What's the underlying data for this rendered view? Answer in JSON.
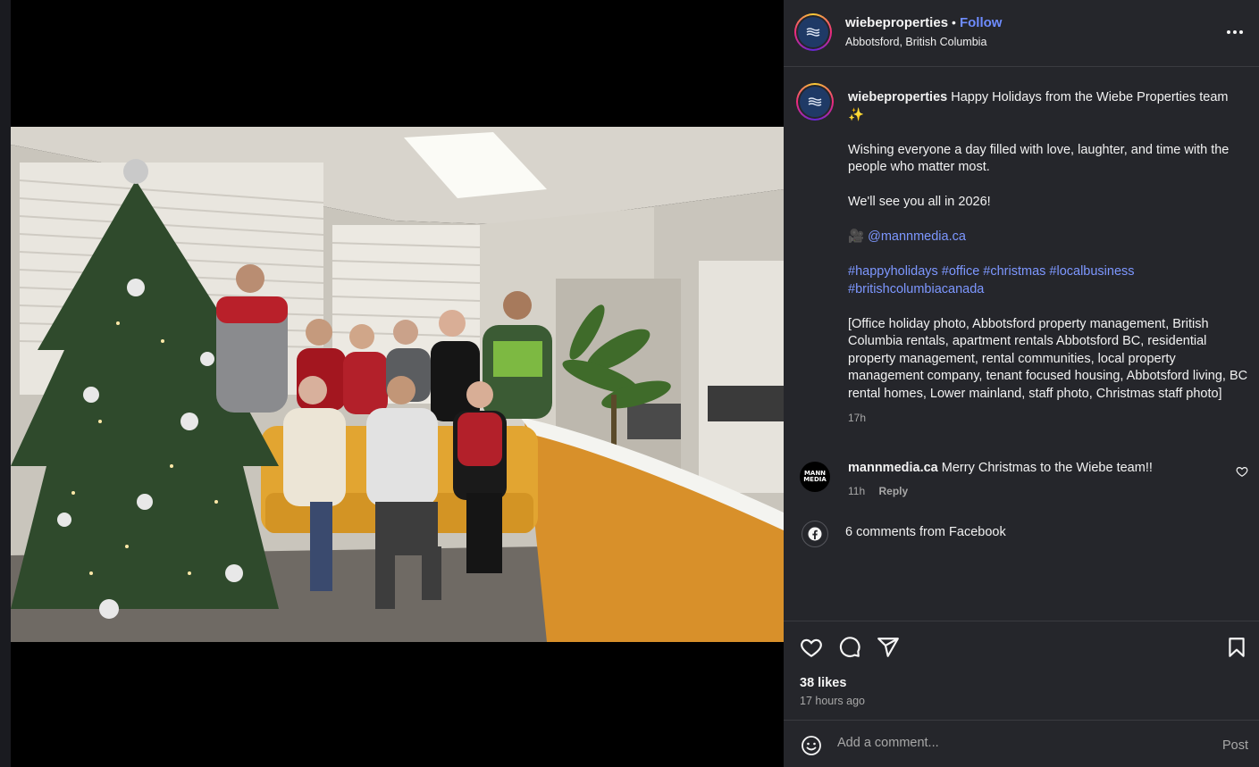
{
  "post": {
    "username": "wiebeproperties",
    "dot": "•",
    "follow_label": "Follow",
    "location": "Abbotsford, British Columbia",
    "more_icon": "more-horizontal-icon"
  },
  "caption": {
    "username": "wiebeproperties",
    "title": "Happy Holidays from the Wiebe Properties team",
    "sparkle": "✨",
    "line1": "Wishing everyone a day filled with love, laughter, and time with the people who matter most.",
    "line2": "We'll see you all in 2026!",
    "camera_emoji": "🎥",
    "mention": "@mannmedia.ca",
    "hashtags_1": "#happyholidays #office #christmas #localbusiness",
    "hashtags_2": "#britishcolumbiacanada",
    "alt_text": "[Office holiday photo, Abbotsford property management, British Columbia rentals, apartment rentals Abbotsford BC, residential property management, rental communities, local property management company, tenant focused housing, Abbotsford living, BC rental homes, Lower mainland, staff photo, Christmas staff photo]",
    "time": "17h"
  },
  "comment": {
    "avatar_text_1": "MANN",
    "avatar_text_2": "MEDIA",
    "username": "mannmedia.ca",
    "text": "Merry Christmas to the Wiebe team!!",
    "time": "11h",
    "reply_label": "Reply"
  },
  "facebook": {
    "text": "6 comments from Facebook"
  },
  "actions": {
    "likes": "38 likes",
    "posted_ago": "17 hours ago"
  },
  "add_comment": {
    "placeholder": "Add a comment...",
    "post_label": "Post"
  },
  "colors": {
    "panel_bg": "#25262b",
    "link": "#7d97ff",
    "follow": "#6e8cff"
  }
}
